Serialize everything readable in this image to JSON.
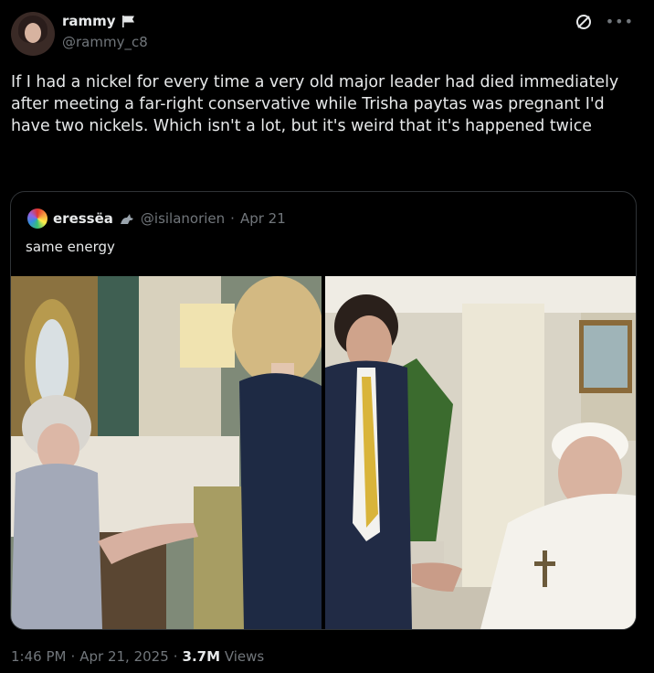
{
  "author": {
    "display_name": "rammy",
    "handle": "@rammy_c8"
  },
  "tweet": {
    "text": "If I had a nickel for every time a very old major leader had died immediately after meeting a far-right conservative while Trisha paytas was pregnant I'd have two nickels. Which isn't a lot, but it's weird that it's happened twice"
  },
  "quote": {
    "display_name": "eressëa",
    "handle": "@isilanorien",
    "separator": "·",
    "date": "Apr 21",
    "text": "same energy"
  },
  "meta": {
    "time": "1:46 PM",
    "separator": "·",
    "date": "Apr 21, 2025",
    "separator2": "·",
    "views_count": "3.7M",
    "views_label": "Views"
  },
  "icons": {
    "flag": "flag-icon",
    "grok": "grok-icon",
    "more": "more-icon",
    "badge": "animal-badge-icon"
  }
}
